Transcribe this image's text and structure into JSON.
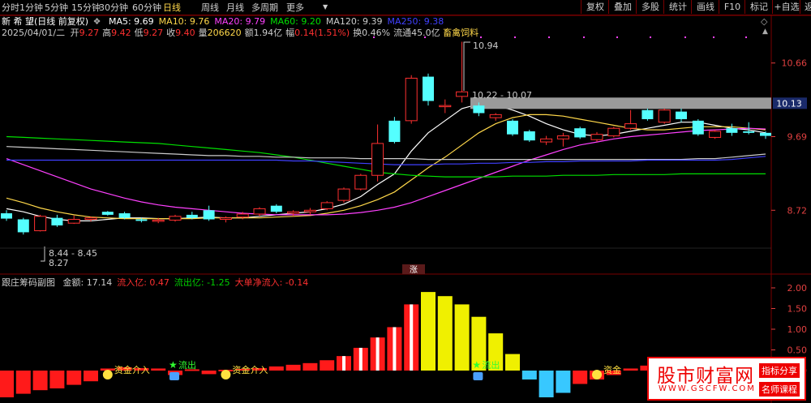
{
  "toolbar": {
    "tabs": [
      "分时",
      "1分钟",
      "5分钟",
      "15分钟",
      "30分钟",
      "60分钟",
      "日线",
      "周线",
      "月线",
      "多周期",
      "更多"
    ],
    "active": "日线",
    "right": [
      "复权",
      "叠加",
      "多股",
      "统计",
      "画线",
      "F10",
      "标记",
      "+自选",
      "返回"
    ]
  },
  "info": {
    "stock": "新 希 望(日线 前复权)",
    "ma": [
      {
        "label": "MA5: 9.69",
        "color": "#ffffff"
      },
      {
        "label": "MA10: 9.76",
        "color": "#ffd84a"
      },
      {
        "label": "MA20: 9.79",
        "color": "#ff40ff"
      },
      {
        "label": "MA60: 9.20",
        "color": "#00e000"
      },
      {
        "label": "MA120: 9.39",
        "color": "#cccccc"
      },
      {
        "label": "MA250: 9.38",
        "color": "#4040ff"
      }
    ],
    "date": "2025/04/01/二",
    "kv": [
      {
        "k": "开",
        "v": "9.27"
      },
      {
        "k": "高",
        "v": "9.42"
      },
      {
        "k": "低",
        "v": "9.27"
      },
      {
        "k": "收",
        "v": "9.40"
      },
      {
        "k": "量",
        "v": "206620"
      },
      {
        "k": "额",
        "v": "1.94亿"
      },
      {
        "k": "幅",
        "v": "0.14(1.51%)"
      },
      {
        "k": "换",
        "v": "0.46%"
      },
      {
        "k": "流通",
        "v": "45.0亿"
      }
    ],
    "sector": "畜禽饲料"
  },
  "chart_data": [
    {
      "type": "candlestick",
      "y_ticks": [
        "10.66",
        "9.69",
        "8.72"
      ],
      "current_price": "10.13",
      "annotations": {
        "high": "10.94",
        "range_high": "10.22 - 10.07",
        "range_low": "8.44 - 8.45",
        "low": "8.27",
        "tag": "涨"
      },
      "candles": [
        {
          "o": 8.68,
          "h": 8.72,
          "l": 8.58,
          "c": 8.61
        },
        {
          "o": 8.6,
          "h": 8.62,
          "l": 8.4,
          "c": 8.43
        },
        {
          "o": 8.45,
          "h": 8.66,
          "l": 8.44,
          "c": 8.64
        },
        {
          "o": 8.62,
          "h": 8.66,
          "l": 8.5,
          "c": 8.52
        },
        {
          "o": 8.55,
          "h": 8.65,
          "l": 8.54,
          "c": 8.6
        },
        {
          "o": 8.6,
          "h": 8.64,
          "l": 8.57,
          "c": 8.62
        },
        {
          "o": 8.7,
          "h": 8.71,
          "l": 8.65,
          "c": 8.66
        },
        {
          "o": 8.68,
          "h": 8.7,
          "l": 8.6,
          "c": 8.62
        },
        {
          "o": 8.6,
          "h": 8.62,
          "l": 8.56,
          "c": 8.58
        },
        {
          "o": 8.58,
          "h": 8.62,
          "l": 8.55,
          "c": 8.59
        },
        {
          "o": 8.59,
          "h": 8.66,
          "l": 8.57,
          "c": 8.64
        },
        {
          "o": 8.66,
          "h": 8.7,
          "l": 8.6,
          "c": 8.62
        },
        {
          "o": 8.72,
          "h": 8.78,
          "l": 8.58,
          "c": 8.6
        },
        {
          "o": 8.6,
          "h": 8.64,
          "l": 8.56,
          "c": 8.62
        },
        {
          "o": 8.63,
          "h": 8.7,
          "l": 8.6,
          "c": 8.67
        },
        {
          "o": 8.67,
          "h": 8.76,
          "l": 8.64,
          "c": 8.74
        },
        {
          "o": 8.78,
          "h": 8.8,
          "l": 8.68,
          "c": 8.7
        },
        {
          "o": 8.68,
          "h": 8.72,
          "l": 8.64,
          "c": 8.7
        },
        {
          "o": 8.7,
          "h": 8.75,
          "l": 8.66,
          "c": 8.72
        },
        {
          "o": 8.74,
          "h": 8.84,
          "l": 8.72,
          "c": 8.82
        },
        {
          "o": 8.85,
          "h": 9.02,
          "l": 8.82,
          "c": 9.0
        },
        {
          "o": 9.0,
          "h": 9.2,
          "l": 8.98,
          "c": 9.18
        },
        {
          "o": 9.18,
          "h": 9.85,
          "l": 9.1,
          "c": 9.6
        },
        {
          "o": 9.9,
          "h": 9.95,
          "l": 9.6,
          "c": 9.62
        },
        {
          "o": 9.9,
          "h": 10.5,
          "l": 9.86,
          "c": 10.46
        },
        {
          "o": 10.48,
          "h": 10.52,
          "l": 10.1,
          "c": 10.16
        },
        {
          "o": 10.1,
          "h": 10.18,
          "l": 10.0,
          "c": 10.1
        },
        {
          "o": 10.22,
          "h": 10.94,
          "l": 10.14,
          "c": 10.28
        },
        {
          "o": 10.1,
          "h": 10.14,
          "l": 9.96,
          "c": 10.0
        },
        {
          "o": 9.94,
          "h": 10.0,
          "l": 9.9,
          "c": 9.98
        },
        {
          "o": 9.9,
          "h": 9.92,
          "l": 9.7,
          "c": 9.72
        },
        {
          "o": 9.76,
          "h": 9.78,
          "l": 9.62,
          "c": 9.64
        },
        {
          "o": 9.62,
          "h": 9.7,
          "l": 9.58,
          "c": 9.66
        },
        {
          "o": 9.66,
          "h": 9.74,
          "l": 9.56,
          "c": 9.7
        },
        {
          "o": 9.8,
          "h": 9.82,
          "l": 9.66,
          "c": 9.68
        },
        {
          "o": 9.65,
          "h": 9.75,
          "l": 9.62,
          "c": 9.72
        },
        {
          "o": 9.7,
          "h": 9.82,
          "l": 9.68,
          "c": 9.8
        },
        {
          "o": 9.8,
          "h": 10.04,
          "l": 9.78,
          "c": 9.86
        },
        {
          "o": 10.04,
          "h": 10.06,
          "l": 9.9,
          "c": 9.92
        },
        {
          "o": 9.88,
          "h": 10.06,
          "l": 9.86,
          "c": 10.04
        },
        {
          "o": 10.02,
          "h": 10.06,
          "l": 9.88,
          "c": 9.92
        },
        {
          "o": 9.9,
          "h": 9.92,
          "l": 9.7,
          "c": 9.72
        },
        {
          "o": 9.68,
          "h": 9.78,
          "l": 9.66,
          "c": 9.76
        },
        {
          "o": 9.8,
          "h": 9.86,
          "l": 9.7,
          "c": 9.74
        },
        {
          "o": 9.76,
          "h": 9.88,
          "l": 9.72,
          "c": 9.74
        },
        {
          "o": 9.74,
          "h": 9.76,
          "l": 9.66,
          "c": 9.7
        }
      ],
      "lines": [
        {
          "name": "MA5",
          "color": "#ffffff",
          "values": [
            8.74,
            8.7,
            8.64,
            8.6,
            8.58,
            8.58,
            8.6,
            8.62,
            8.62,
            8.61,
            8.61,
            8.62,
            8.63,
            8.62,
            8.62,
            8.64,
            8.66,
            8.68,
            8.7,
            8.74,
            8.8,
            8.9,
            9.06,
            9.2,
            9.5,
            9.74,
            9.9,
            10.06,
            10.12,
            10.1,
            10.04,
            9.96,
            9.86,
            9.78,
            9.72,
            9.7,
            9.72,
            9.76,
            9.8,
            9.84,
            9.88,
            9.88,
            9.84,
            9.8,
            9.78,
            9.74
          ]
        },
        {
          "name": "MA10",
          "color": "#ffd84a",
          "values": [
            8.88,
            8.82,
            8.75,
            8.7,
            8.66,
            8.63,
            8.62,
            8.61,
            8.61,
            8.61,
            8.61,
            8.61,
            8.62,
            8.62,
            8.62,
            8.62,
            8.63,
            8.64,
            8.65,
            8.68,
            8.72,
            8.78,
            8.86,
            8.96,
            9.12,
            9.28,
            9.42,
            9.58,
            9.74,
            9.86,
            9.94,
            9.98,
            9.98,
            9.96,
            9.92,
            9.88,
            9.84,
            9.8,
            9.78,
            9.78,
            9.8,
            9.82,
            9.82,
            9.82,
            9.8,
            9.78
          ]
        },
        {
          "name": "MA20",
          "color": "#ff40ff",
          "values": [
            9.4,
            9.32,
            9.24,
            9.16,
            9.08,
            9.0,
            8.94,
            8.88,
            8.83,
            8.79,
            8.76,
            8.74,
            8.72,
            8.7,
            8.68,
            8.67,
            8.66,
            8.66,
            8.66,
            8.66,
            8.67,
            8.69,
            8.72,
            8.76,
            8.82,
            8.9,
            8.98,
            9.06,
            9.14,
            9.22,
            9.3,
            9.38,
            9.45,
            9.52,
            9.58,
            9.62,
            9.66,
            9.69,
            9.71,
            9.73,
            9.75,
            9.77,
            9.78,
            9.79,
            9.8,
            9.79
          ]
        },
        {
          "name": "MA60",
          "color": "#00e000",
          "values": [
            9.69,
            9.68,
            9.67,
            9.66,
            9.65,
            9.64,
            9.63,
            9.62,
            9.61,
            9.6,
            9.58,
            9.56,
            9.54,
            9.52,
            9.5,
            9.48,
            9.45,
            9.42,
            9.38,
            9.34,
            9.3,
            9.26,
            9.22,
            9.2,
            9.18,
            9.17,
            9.16,
            9.16,
            9.16,
            9.16,
            9.17,
            9.17,
            9.17,
            9.18,
            9.18,
            9.18,
            9.19,
            9.19,
            9.19,
            9.19,
            9.2,
            9.2,
            9.2,
            9.2,
            9.2,
            9.2
          ]
        },
        {
          "name": "MA120",
          "color": "#cccccc",
          "values": [
            9.56,
            9.55,
            9.54,
            9.53,
            9.52,
            9.51,
            9.5,
            9.49,
            9.48,
            9.47,
            9.46,
            9.45,
            9.44,
            9.44,
            9.43,
            9.43,
            9.42,
            9.42,
            9.41,
            9.41,
            9.41,
            9.4,
            9.4,
            9.4,
            9.4,
            9.39,
            9.39,
            9.39,
            9.39,
            9.39,
            9.39,
            9.39,
            9.39,
            9.39,
            9.39,
            9.39,
            9.39,
            9.39,
            9.39,
            9.39,
            9.39,
            9.4,
            9.4,
            9.42,
            9.44,
            9.46
          ]
        },
        {
          "name": "MA250",
          "color": "#4040ff",
          "values": [
            9.38,
            9.38,
            9.38,
            9.38,
            9.38,
            9.38,
            9.38,
            9.38,
            9.38,
            9.38,
            9.38,
            9.38,
            9.38,
            9.38,
            9.38,
            9.38,
            9.38,
            9.37,
            9.37,
            9.36,
            9.35,
            9.34,
            9.33,
            9.32,
            9.32,
            9.32,
            9.33,
            9.33,
            9.34,
            9.34,
            9.35,
            9.35,
            9.36,
            9.36,
            9.37,
            9.37,
            9.37,
            9.37,
            9.38,
            9.38,
            9.38,
            9.38,
            9.38,
            9.39,
            9.41,
            9.43
          ]
        }
      ]
    },
    {
      "type": "bar",
      "title": "跟庄筹码副图",
      "stats": [
        {
          "label": "金额: 17.14",
          "color": "#cccccc"
        },
        {
          "label": "流入亿: 0.47",
          "color": "#ff3030"
        },
        {
          "label": "流出亿: -1.25",
          "color": "#00d000"
        },
        {
          "label": "大单净流入: -0.14",
          "color": "#ff3030"
        }
      ],
      "y_ticks": [
        "2.00",
        "1.50",
        "1.00",
        "0.50",
        "0.00"
      ],
      "signals": [
        {
          "i": 6,
          "label": "资金介入"
        },
        {
          "i": 10,
          "label": "流出"
        },
        {
          "i": 13,
          "label": "资金介入"
        },
        {
          "i": 28,
          "label": "流出"
        },
        {
          "i": 35,
          "label": "资金"
        }
      ],
      "values": [
        -0.3,
        -0.26,
        -0.22,
        -0.2,
        -0.16,
        -0.12,
        0.05,
        0.08,
        0.06,
        0.05,
        -0.05,
        0.03,
        -0.04,
        0.02,
        0.04,
        0.06,
        0.1,
        0.14,
        0.18,
        0.25,
        0.35,
        0.55,
        0.8,
        1.05,
        1.6,
        1.9,
        1.8,
        1.6,
        1.3,
        0.9,
        0.4,
        -0.1,
        -0.3,
        -0.25,
        -0.15,
        -0.1,
        -0.05,
        0.05,
        0.12,
        0.18,
        0.22,
        0.2,
        0.15,
        0.1,
        0.05,
        0.02
      ]
    }
  ],
  "watermark": {
    "title": "股市财富网",
    "url": "WWW.GSCFW.COM",
    "tag1": "指标分享",
    "tag2": "名师课程"
  }
}
